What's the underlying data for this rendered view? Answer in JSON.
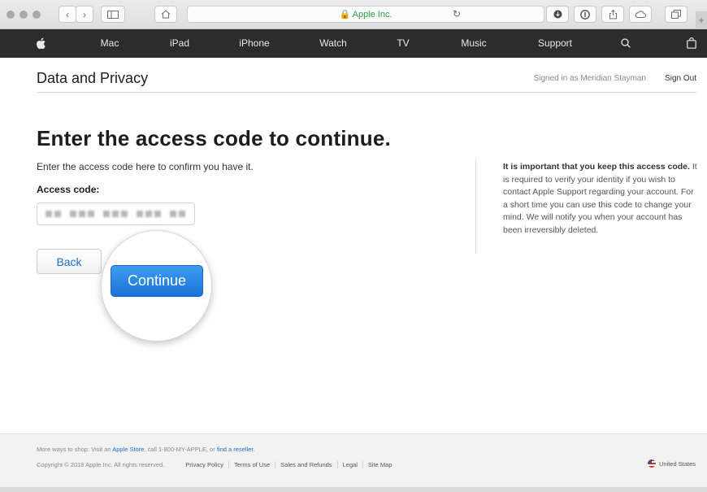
{
  "browser": {
    "address": "Apple Inc.",
    "buttons": [
      "back-button",
      "forward-button",
      "sidebar-button",
      "home-button",
      "reload-button",
      "download-button",
      "info-button",
      "share-button",
      "cloud-button",
      "tabs-button",
      "new-tab-button"
    ]
  },
  "nav": {
    "items": [
      {
        "label": "Mac"
      },
      {
        "label": "iPad"
      },
      {
        "label": "iPhone"
      },
      {
        "label": "Watch"
      },
      {
        "label": "TV"
      },
      {
        "label": "Music"
      },
      {
        "label": "Support"
      }
    ],
    "icons": [
      "apple-logo-icon",
      "search-icon",
      "bag-icon"
    ]
  },
  "header": {
    "title": "Data and Privacy",
    "signed_in": "Signed in as Meridian Stayman",
    "sign_out": "Sign Out"
  },
  "main": {
    "heading": "Enter the access code to continue.",
    "instructions": "Enter the access code here to confirm you have it.",
    "code_label": "Access code:",
    "back_label": "Back",
    "continue_label": "Continue"
  },
  "side_note": {
    "bold": "It is important that you keep this access code.",
    "text": " It is required to verify your identity if you wish to contact Apple Support regarding your account. For a short time you can use this code to change your mind. We will notify you when your account has been irreversibly deleted."
  },
  "footer": {
    "shop_prefix": "More ways to shop: Visit an ",
    "apple_store": "Apple Store",
    "shop_middle": ", call 1-800-MY-APPLE, or ",
    "find_reseller": "find a reseller",
    "shop_suffix": ".",
    "copyright": "Copyright © 2018 Apple Inc. All rights reserved.",
    "links": [
      "Privacy Policy",
      "Terms of Use",
      "Sales and Refunds",
      "Legal",
      "Site Map"
    ],
    "country": "United States"
  },
  "colors": {
    "nav_bg": "#2c2c2c",
    "link": "#1f6fc5",
    "continue_button": "#1a73d6",
    "secure_address": "#2a9d3c"
  }
}
